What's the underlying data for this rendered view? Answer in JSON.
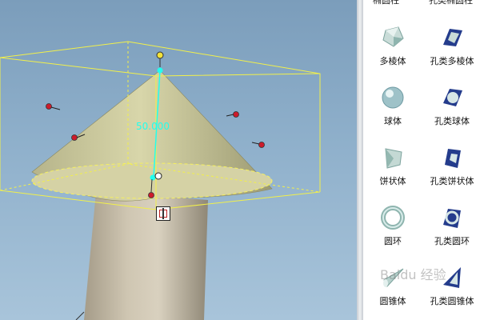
{
  "viewport": {
    "dimension_value": "50.000"
  },
  "palette": {
    "partial_top_labels": [
      "椭圆柱",
      "孔类椭圆柱"
    ],
    "items": [
      {
        "label": "多棱体",
        "icon": "polyhedron-icon"
      },
      {
        "label": "孔类多棱体",
        "icon": "hole-polyhedron-icon"
      },
      {
        "label": "球体",
        "icon": "sphere-icon"
      },
      {
        "label": "孔类球体",
        "icon": "hole-sphere-icon"
      },
      {
        "label": "饼状体",
        "icon": "wedge-icon"
      },
      {
        "label": "孔类饼状体",
        "icon": "hole-wedge-icon"
      },
      {
        "label": "圆环",
        "icon": "torus-icon"
      },
      {
        "label": "孔类圆环",
        "icon": "hole-torus-icon"
      },
      {
        "label": "圆锥体",
        "icon": "cone-icon"
      },
      {
        "label": "孔类圆锥体",
        "icon": "hole-cone-icon"
      }
    ]
  },
  "watermark": {
    "text": "Baidu 经验"
  }
}
